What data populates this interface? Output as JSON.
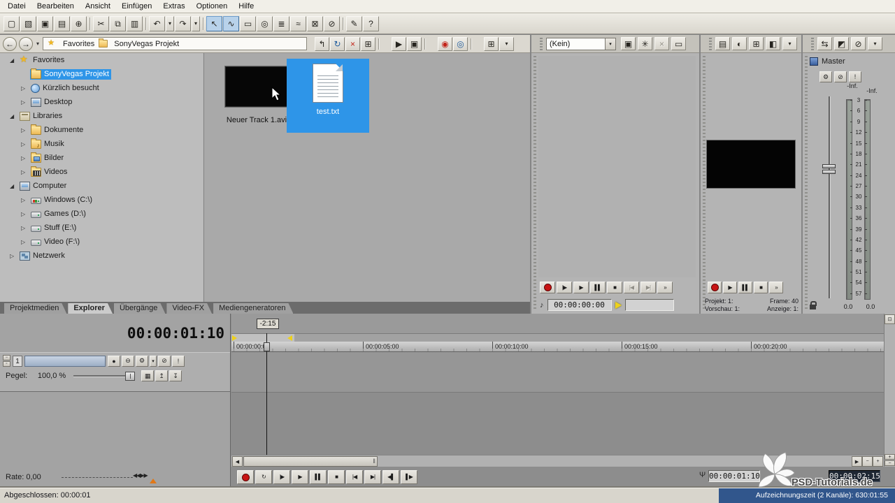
{
  "colors": {
    "sel": "#2e95e8",
    "record": "#c81414",
    "loop-yellow": "#edd11a",
    "status-blue": "#31568c",
    "tool-active": "#b8d2ea"
  },
  "menubar": {
    "items": [
      "Datei",
      "Bearbeiten",
      "Ansicht",
      "Einfügen",
      "Extras",
      "Optionen",
      "Hilfe"
    ]
  },
  "toolbar": {
    "buttons": [
      {
        "name": "new-project-icon",
        "glyph": "▢"
      },
      {
        "name": "open-project-icon",
        "glyph": "▧"
      },
      {
        "name": "save-project-icon",
        "glyph": "▣"
      },
      {
        "name": "project-properties-icon",
        "glyph": "▤"
      },
      {
        "name": "import-media-icon",
        "glyph": "⊕"
      },
      {
        "cls": "sep"
      },
      {
        "name": "cut-icon",
        "glyph": "✂"
      },
      {
        "name": "copy-icon",
        "glyph": "⧉"
      },
      {
        "name": "paste-icon",
        "glyph": "▥"
      },
      {
        "cls": "sep"
      },
      {
        "name": "undo-icon",
        "glyph": "↶"
      },
      {
        "name": "undo-menu-icon",
        "glyph": "▾",
        "cls": "narrow"
      },
      {
        "name": "redo-icon",
        "glyph": "↷"
      },
      {
        "name": "redo-menu-icon",
        "glyph": "▾",
        "cls": "narrow"
      },
      {
        "cls": "sep"
      },
      {
        "name": "normal-edit-tool-icon",
        "glyph": "↖",
        "cls": "active"
      },
      {
        "name": "envelope-edit-tool-icon",
        "glyph": "∿",
        "cls": "active"
      },
      {
        "name": "selection-edit-tool-icon",
        "glyph": "▭"
      },
      {
        "name": "zoom-edit-tool-icon",
        "glyph": "◎"
      },
      {
        "name": "enable-snapping-icon",
        "glyph": "≣"
      },
      {
        "name": "auto-ripple-icon",
        "glyph": "≈"
      },
      {
        "name": "lock-envelopes-icon",
        "glyph": "⊠"
      },
      {
        "name": "ignore-event-grouping-icon",
        "glyph": "⊘"
      },
      {
        "cls": "sep"
      },
      {
        "name": "pen-tool-icon",
        "glyph": "✎"
      },
      {
        "name": "whats-this-help-icon",
        "glyph": "?"
      }
    ]
  },
  "icons": {
    "back": "←",
    "forward": "→",
    "chevron": "▾",
    "scroll_left": "◀",
    "scroll_right": "▶",
    "zoom_in": "+",
    "zoom_out": "−",
    "pane_toggle": "⊡",
    "track_min": "−",
    "track_restore": "▫",
    "mic": "Ψ",
    "audio": "♪"
  },
  "explorer": {
    "breadcrumb": [
      {
        "label": "Favorites"
      },
      {
        "label": "SonyVegas Projekt"
      }
    ],
    "nav_icons": [
      {
        "name": "up-one-level-icon",
        "glyph": "↰"
      },
      {
        "name": "refresh-icon",
        "glyph": "↻",
        "cls": "blue"
      },
      {
        "name": "delete-icon",
        "glyph": "×",
        "cls": "red"
      },
      {
        "name": "new-folder-icon",
        "glyph": "⊞"
      },
      {
        "cls": "sep"
      },
      {
        "name": "start-preview-icon",
        "glyph": "▶"
      },
      {
        "name": "auto-preview-icon",
        "glyph": "▣"
      },
      {
        "cls": "sep"
      },
      {
        "name": "media-manager-icon",
        "glyph": "◉",
        "cls": "red"
      },
      {
        "name": "media-search-icon",
        "glyph": "◎",
        "cls": "blue"
      },
      {
        "cls": "sep"
      },
      {
        "name": "views-icon",
        "glyph": "⊞"
      },
      {
        "name": "views-menu-icon",
        "glyph": "▾",
        "cls": "narrow"
      }
    ],
    "tree": [
      {
        "label": "Favorites",
        "arrow": "◢",
        "icon": "fav",
        "cls": "lvl0"
      },
      {
        "label": "SonyVegas Projekt",
        "arrow": "",
        "icon": "folder",
        "cls": "lvl1 sel"
      },
      {
        "label": "Kürzlich besucht",
        "arrow": "▷",
        "icon": "recent",
        "cls": "lvl1"
      },
      {
        "label": "Desktop",
        "arrow": "▷",
        "icon": "desktop",
        "cls": "lvl1"
      },
      {
        "label": "Libraries",
        "arrow": "◢",
        "icon": "lib",
        "cls": "lvl0"
      },
      {
        "label": "Dokumente",
        "arrow": "▷",
        "icon": "docs",
        "cls": "lvl1"
      },
      {
        "label": "Musik",
        "arrow": "▷",
        "icon": "music",
        "cls": "lvl1"
      },
      {
        "label": "Bilder",
        "arrow": "▷",
        "icon": "pics",
        "cls": "lvl1"
      },
      {
        "label": "Videos",
        "arrow": "▷",
        "icon": "vids",
        "cls": "lvl1"
      },
      {
        "label": "Computer",
        "arrow": "◢",
        "icon": "computer",
        "cls": "lvl0"
      },
      {
        "label": "Windows (C:\\)",
        "arrow": "▷",
        "icon": "sysdrive",
        "cls": "lvl1"
      },
      {
        "label": "Games (D:\\)",
        "arrow": "▷",
        "icon": "drive",
        "cls": "lvl1"
      },
      {
        "label": "Stuff (E:\\)",
        "arrow": "▷",
        "icon": "drive",
        "cls": "lvl1"
      },
      {
        "label": "Video (F:\\)",
        "arrow": "▷",
        "icon": "drive",
        "cls": "lvl1"
      },
      {
        "label": "Netzwerk",
        "arrow": "▷",
        "icon": "network",
        "cls": "lvl0"
      }
    ],
    "files": [
      {
        "name": "Neuer Track 1.avi"
      },
      {
        "name": "test.txt"
      }
    ],
    "tabs": [
      {
        "label": "Projektmedien"
      },
      {
        "label": "Explorer",
        "cls": "active"
      },
      {
        "label": "Übergänge"
      },
      {
        "label": "Video-FX"
      },
      {
        "label": "Mediengeneratoren"
      }
    ]
  },
  "trimmer": {
    "preset": "(Kein)",
    "icons": [
      {
        "name": "save-preset-icon",
        "glyph": "▣"
      },
      {
        "name": "plugin-chain-icon",
        "glyph": "✳"
      },
      {
        "name": "remove-plugin-icon",
        "glyph": "×",
        "cls": "dis"
      },
      {
        "name": "external-monitor-icon",
        "glyph": "▭"
      }
    ],
    "transport": [
      {
        "name": "record-button",
        "cls": "rec"
      },
      {
        "name": "play-from-start-button",
        "glyph": "|▶"
      },
      {
        "name": "play-button",
        "glyph": "▶"
      },
      {
        "name": "pause-button",
        "glyph": "▌▌"
      },
      {
        "name": "stop-button",
        "glyph": "■"
      },
      {
        "name": "go-to-start-button",
        "glyph": "|◀",
        "cls": "dis"
      },
      {
        "name": "go-to-end-button",
        "glyph": "▶|",
        "cls": "dis"
      },
      {
        "name": "overflow-button",
        "glyph": "»"
      }
    ],
    "timecode": "00:00:00:00"
  },
  "preview": {
    "icons": [
      {
        "name": "project-video-properties-icon",
        "glyph": "▤"
      },
      {
        "name": "preview-quality-icon",
        "glyph": "◐"
      },
      {
        "name": "overlays-icon",
        "glyph": "⊞"
      },
      {
        "name": "split-screen-icon",
        "glyph": "◧"
      },
      {
        "name": "panel-menu-icon",
        "glyph": "▾",
        "cls": "narrow"
      }
    ],
    "transport": [
      {
        "name": "record-button",
        "cls": "rec"
      },
      {
        "name": "play-button",
        "glyph": "▶"
      },
      {
        "name": "pause-button",
        "glyph": "▌▌"
      },
      {
        "name": "stop-button",
        "glyph": "■"
      },
      {
        "name": "overflow-button",
        "glyph": "»"
      }
    ],
    "info": {
      "r1l": "Projekt: 1:",
      "r1r": "Frame: 40",
      "r2l": "Vorschau: 1:",
      "r2r": "Anzeige: 1:"
    }
  },
  "master": {
    "label": "Master",
    "icons": [
      {
        "name": "downmix-output-icon",
        "glyph": "⇆"
      },
      {
        "name": "dim-output-icon",
        "glyph": "◩"
      },
      {
        "name": "master-mute-icon",
        "glyph": "⊘"
      },
      {
        "name": "panel-menu-icon",
        "glyph": "▾",
        "cls": "narrow"
      }
    ],
    "ctl_icons": [
      {
        "name": "insert-fx-icon",
        "glyph": "⚙"
      },
      {
        "name": "mute-icon",
        "glyph": "⊘"
      },
      {
        "name": "solo-icon",
        "glyph": "!"
      }
    ],
    "fader_values": [
      "-Inf.",
      "-Inf."
    ],
    "scale": [
      "3",
      "6",
      "9",
      "12",
      "15",
      "18",
      "21",
      "24",
      "27",
      "30",
      "33",
      "36",
      "39",
      "42",
      "45",
      "48",
      "51",
      "54",
      "57"
    ],
    "meter_values": [
      "0.0",
      "0.0"
    ]
  },
  "timeline": {
    "current_time": "00:00:01:10",
    "marker_label": "-2:15",
    "ruler_ticks": [
      {
        "label": "00:00:00:00"
      },
      {
        "label": "00:00:05:00"
      },
      {
        "label": "00:00:10:00"
      },
      {
        "label": "00:00:15:00"
      },
      {
        "label": "00:00:20:00"
      }
    ],
    "track": {
      "number": "1",
      "name": "",
      "level_label": "Pegel:",
      "level_value": "100,0 %",
      "icons_a": [
        {
          "name": "arm-record-icon",
          "glyph": "●"
        },
        {
          "name": "invert-phase-icon",
          "glyph": "⊖"
        },
        {
          "name": "track-fx-icon",
          "glyph": "⚙"
        },
        {
          "name": "fx-menu-icon",
          "glyph": "▾",
          "cls": "narrow"
        },
        {
          "name": "mute-icon",
          "glyph": "⊘"
        },
        {
          "name": "solo-icon",
          "glyph": "!"
        }
      ],
      "icons_b": [
        {
          "name": "input-meters-icon",
          "glyph": "▦"
        },
        {
          "name": "fade-up-icon",
          "glyph": "↥"
        },
        {
          "name": "fade-down-icon",
          "glyph": "↧"
        }
      ]
    },
    "rate_label": "Rate: 0,00",
    "rate_thumb": "◀◀▶▶",
    "transport": [
      {
        "name": "record-button",
        "cls": "rec"
      },
      {
        "name": "loop-playback-button",
        "glyph": "↻"
      },
      {
        "name": "play-from-start-button",
        "glyph": "|▶"
      },
      {
        "name": "play-button",
        "glyph": "▶"
      },
      {
        "name": "pause-button",
        "glyph": "▌▌"
      },
      {
        "name": "stop-button",
        "glyph": "■"
      },
      {
        "name": "go-to-start-button",
        "glyph": "|◀"
      },
      {
        "name": "go-to-end-button",
        "glyph": "▶|"
      },
      {
        "name": "prev-frame-button",
        "glyph": "◀▌"
      },
      {
        "name": "next-frame-button",
        "glyph": "▌▶"
      }
    ],
    "record_time": "00:00:01:10",
    "selection_end_time": "00:00:02:15"
  },
  "statusbar": {
    "left": "Abgeschlossen: 00:00:01",
    "right": "Aufzeichnungszeit (2 Kanäle): 630:01:55"
  },
  "watermark": {
    "text": "PSD-Tutorials.de"
  }
}
